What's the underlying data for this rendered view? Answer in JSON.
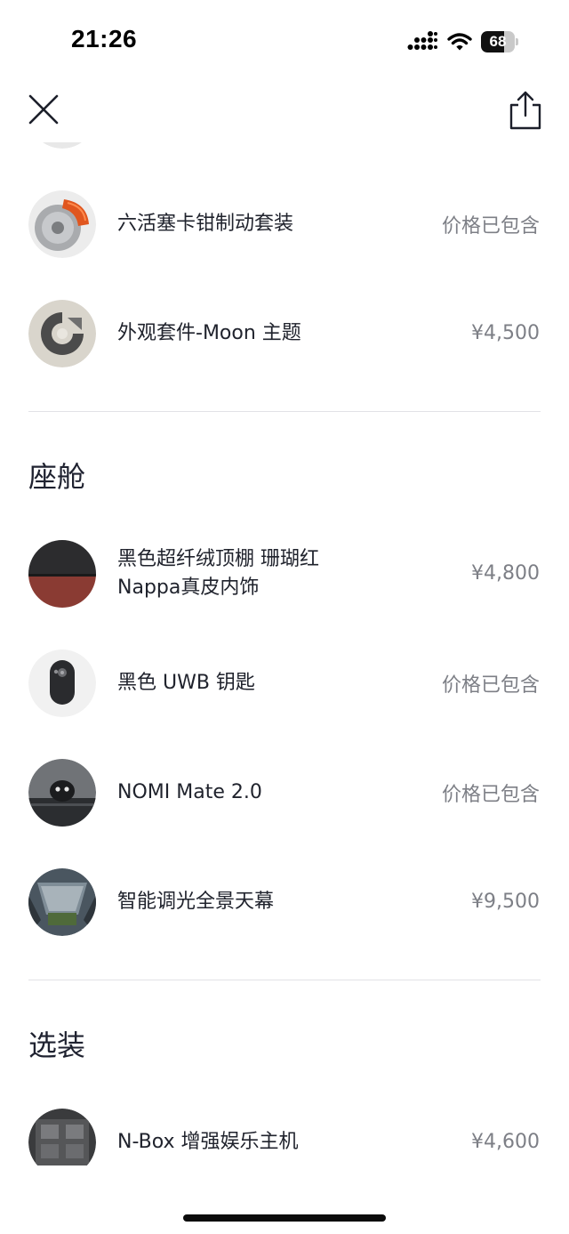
{
  "status_bar": {
    "time": "21:26",
    "battery": "68",
    "battery_level_percent": 68
  },
  "nav": {
    "close_icon": "close-icon",
    "share_icon": "share-icon"
  },
  "top_items": [
    {
      "name": "",
      "price": "",
      "thumb": "wheel-partial"
    },
    {
      "name": "六活塞卡钳制动套装",
      "price": "价格已包含",
      "thumb": "brake-caliper"
    },
    {
      "name": "外观套件-Moon 主题",
      "price": "¥4,500",
      "thumb": "moon-theme"
    }
  ],
  "sections": [
    {
      "title": "座舱",
      "items": [
        {
          "name_line1": "黑色超纤绒顶棚 珊瑚红",
          "name_line2": "Nappa真皮内饰",
          "price": "¥4,800",
          "thumb": "interior-swatch"
        },
        {
          "name_line1": "黑色 UWB 钥匙",
          "name_line2": "",
          "price": "价格已包含",
          "thumb": "uwb-key"
        },
        {
          "name_line1": "NOMI Mate 2.0",
          "name_line2": "",
          "price": "价格已包含",
          "thumb": "nomi-mate"
        },
        {
          "name_line1": "智能调光全景天幕",
          "name_line2": "",
          "price": "¥9,500",
          "thumb": "panoramic-roof"
        }
      ]
    },
    {
      "title": "选装",
      "items": [
        {
          "name_line1": "N-Box 增强娱乐主机",
          "name_line2": "",
          "price": "¥4,600",
          "thumb": "nbox"
        }
      ]
    }
  ],
  "colors": {
    "text_primary": "#20232d",
    "text_price": "#7d7f86",
    "divider": "#e2e2e6",
    "background": "#ffffff"
  }
}
